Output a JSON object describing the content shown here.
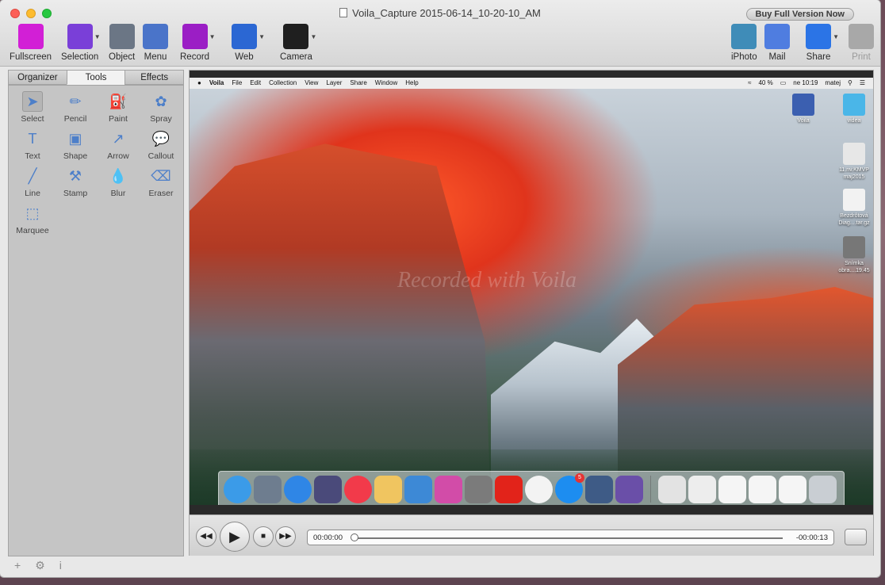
{
  "window": {
    "title": "Voila_Capture 2015-06-14_10-20-10_AM",
    "buy_label": "Buy Full Version Now"
  },
  "toolbar": {
    "left": [
      {
        "label": "Fullscreen",
        "icon": "fullscreen-icon",
        "color": "#d21fd6"
      },
      {
        "label": "Selection",
        "icon": "selection-icon",
        "color": "#7a3fd8"
      },
      {
        "label": "Object",
        "icon": "object-icon",
        "color": "#6b7685"
      },
      {
        "label": "Menu",
        "icon": "menu-icon",
        "color": "#4a74c9"
      },
      {
        "label": "Record",
        "icon": "record-icon",
        "color": "#9b1ec5"
      },
      {
        "label": "Web",
        "icon": "web-icon",
        "color": "#2b67d3"
      },
      {
        "label": "Camera",
        "icon": "camera-icon",
        "color": "#1f1f1f"
      }
    ],
    "right": [
      {
        "label": "iPhoto",
        "icon": "iphoto-icon",
        "color": "#3f8cb8"
      },
      {
        "label": "Mail",
        "icon": "mail-icon",
        "color": "#4f7de0"
      },
      {
        "label": "Share",
        "icon": "share-icon",
        "color": "#2b74e6"
      },
      {
        "label": "Print",
        "icon": "print-icon",
        "color": "#a8a8a8"
      }
    ]
  },
  "sidebar": {
    "tabs": [
      "Organizer",
      "Tools",
      "Effects"
    ],
    "active_tab": "Tools",
    "tools": [
      {
        "label": "Select",
        "icon": "cursor-icon",
        "glyph": "➤"
      },
      {
        "label": "Pencil",
        "icon": "pencil-icon",
        "glyph": "✏"
      },
      {
        "label": "Paint",
        "icon": "paint-bucket-icon",
        "glyph": "⛽"
      },
      {
        "label": "Spray",
        "icon": "spray-icon",
        "glyph": "✿"
      },
      {
        "label": "Text",
        "icon": "text-icon",
        "glyph": "T"
      },
      {
        "label": "Shape",
        "icon": "shape-icon",
        "glyph": "▣"
      },
      {
        "label": "Arrow",
        "icon": "arrow-icon",
        "glyph": "↗"
      },
      {
        "label": "Callout",
        "icon": "callout-icon",
        "glyph": "💬"
      },
      {
        "label": "Line",
        "icon": "line-icon",
        "glyph": "╱"
      },
      {
        "label": "Stamp",
        "icon": "stamp-icon",
        "glyph": "⚒"
      },
      {
        "label": "Blur",
        "icon": "blur-icon",
        "glyph": "💧"
      },
      {
        "label": "Eraser",
        "icon": "eraser-icon",
        "glyph": "⌫"
      },
      {
        "label": "Marquee",
        "icon": "marquee-icon",
        "glyph": "⬚"
      }
    ],
    "footer": [
      "+",
      "⚙",
      "i"
    ]
  },
  "capture": {
    "menubar": {
      "apple": "",
      "items": [
        "Voila",
        "File",
        "Edit",
        "Collection",
        "View",
        "Layer",
        "Share",
        "Window",
        "Help"
      ],
      "battery": "40 %",
      "clock": "ne 10:19",
      "user": "matej"
    },
    "watermark": "Recorded with Voila",
    "desktop_icons": [
      {
        "label": "Voila",
        "color": "#3b5fb0"
      },
      {
        "label": "videa",
        "color": "#4ab6e8"
      },
      {
        "label": "11.nv.KMVP maj2015",
        "color": "#e7e7e7"
      },
      {
        "label": "Bezdrôtová Diag....tar.gz",
        "color": "#f2f2f2"
      },
      {
        "label": "Snímka obra....19.45",
        "color": "#777777"
      }
    ],
    "dock": [
      {
        "name": "finder",
        "color": "#3b9be8"
      },
      {
        "name": "launchpad",
        "color": "#6e7d8f"
      },
      {
        "name": "safari",
        "color": "#2f86e6"
      },
      {
        "name": "imovie",
        "color": "#4a4a7a"
      },
      {
        "name": "itunes",
        "color": "#f23a4a"
      },
      {
        "name": "notes",
        "color": "#f0c560"
      },
      {
        "name": "keynote",
        "color": "#3d89d6"
      },
      {
        "name": "pages",
        "color": "#d24ca8"
      },
      {
        "name": "preferences",
        "color": "#7b7b7b"
      },
      {
        "name": "acrobat",
        "color": "#e2231a"
      },
      {
        "name": "photos",
        "color": "#f3f3f3"
      },
      {
        "name": "app-store",
        "color": "#1d8df0",
        "badge": "5"
      },
      {
        "name": "voila",
        "color": "#3e5b86"
      },
      {
        "name": "feather",
        "color": "#6a4fa8"
      },
      {
        "name": "doc1",
        "color": "#e3e3e3"
      },
      {
        "name": "doc2",
        "color": "#ededed"
      },
      {
        "name": "doc3",
        "color": "#f5f5f5"
      },
      {
        "name": "doc4",
        "color": "#f5f5f5"
      },
      {
        "name": "doc5",
        "color": "#f5f5f5"
      },
      {
        "name": "trash",
        "color": "#c9ced3"
      }
    ]
  },
  "player": {
    "time_current": "00:00:00",
    "time_remaining": "-00:00:13",
    "progress": 0.0
  }
}
